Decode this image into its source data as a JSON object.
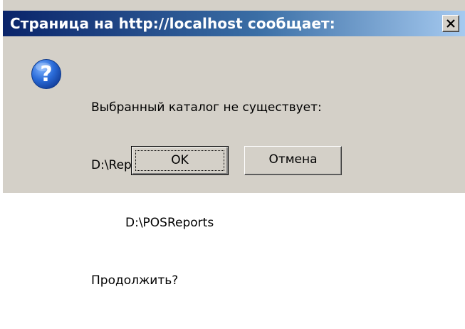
{
  "dialog": {
    "title": "Страница на http://localhost сообщает:",
    "close_glyph": "✕",
    "icon": "question-icon",
    "message_lines": [
      "Выбранный каталог не существует:",
      "D:\\Reports_backup",
      "D:\\POSReports",
      "Продолжить?"
    ],
    "buttons": {
      "ok_label": "OK",
      "cancel_label": "Отмена"
    }
  },
  "colors": {
    "window_bg": "#d4d0c8",
    "title_start": "#0a246a",
    "title_end": "#a6caf0",
    "icon_blue": "#1f5fc9"
  }
}
